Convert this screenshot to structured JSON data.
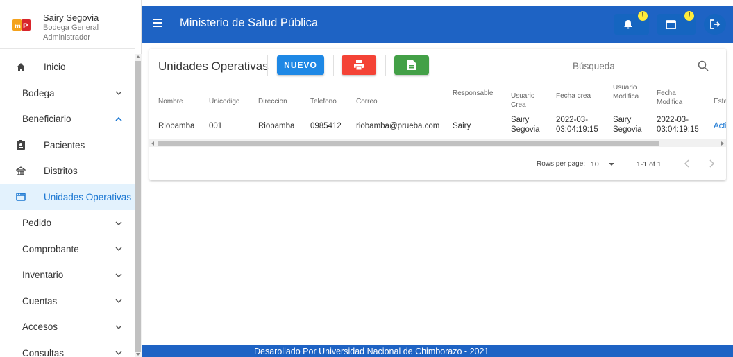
{
  "user": {
    "name": "Sairy Segovia",
    "location": "Bodega General",
    "role": "Administrador"
  },
  "sidebar": {
    "items": [
      {
        "label": "Inicio",
        "icon": "home-icon"
      },
      {
        "label": "Bodega",
        "icon": "chevron-down-icon"
      },
      {
        "label": "Beneficiario",
        "icon": "chevron-up-icon"
      },
      {
        "label": "Pacientes",
        "icon": "badge-icon"
      },
      {
        "label": "Distritos",
        "icon": "bank-icon"
      },
      {
        "label": "Unidades Operativas",
        "icon": "storefront-icon"
      },
      {
        "label": "Pedido",
        "icon": "chevron-down-icon"
      },
      {
        "label": "Comprobante",
        "icon": "chevron-down-icon"
      },
      {
        "label": "Inventario",
        "icon": "chevron-down-icon"
      },
      {
        "label": "Cuentas",
        "icon": "chevron-down-icon"
      },
      {
        "label": "Accesos",
        "icon": "chevron-down-icon"
      },
      {
        "label": "Consultas",
        "icon": "chevron-down-icon"
      }
    ]
  },
  "appbar": {
    "title": "Ministerio de Salud Pública",
    "notification_badge": "!",
    "calendar_badge": "!"
  },
  "card": {
    "title": "Unidades Operativas",
    "new_button": "NUEVO",
    "search_placeholder": "Búsqueda"
  },
  "table": {
    "headers": {
      "nombre": "Nombre",
      "unicodigo": "Unicodigo",
      "direccion": "Direccion",
      "telefono": "Telefono",
      "correo": "Correo",
      "responsable": "Responsable",
      "usuario_crea_1": "Usuario",
      "usuario_crea_2": "Crea",
      "fecha_crea": "Fecha crea",
      "usuario_mod_1": "Usuario",
      "usuario_mod_2": "Modifica",
      "fecha_mod_1": "Fecha",
      "fecha_mod_2": "Modifica",
      "estado": "Esta"
    },
    "rows": [
      {
        "nombre": "Riobamba",
        "unicodigo": "001",
        "direccion": "Riobamba",
        "telefono": "0985412",
        "correo": "riobamba@prueba.com",
        "responsable": "Sairy",
        "usuario_crea_1": "Sairy",
        "usuario_crea_2": "Segovia",
        "fecha_crea_1": "2022-03-",
        "fecha_crea_2": "03:04:19:15",
        "usuario_mod_1": "Sairy",
        "usuario_mod_2": "Segovia",
        "fecha_mod_1": "2022-03-",
        "fecha_mod_2": "03:04:19:15",
        "estado": "Acti"
      }
    ]
  },
  "pagination": {
    "rows_per_page_label": "Rows per page:",
    "rows_per_page": "10",
    "range": "1-1 of 1"
  },
  "footer": {
    "text": "Desarollado Por Universidad Nacional de Chimborazo - 2021"
  },
  "colors": {
    "primary": "#1e63c4",
    "new_button": "#1e88e5",
    "print_button": "#f44336",
    "excel_button": "#43a047",
    "badge": "#ffeb3b",
    "active_item_bg": "#e3f2fd"
  }
}
